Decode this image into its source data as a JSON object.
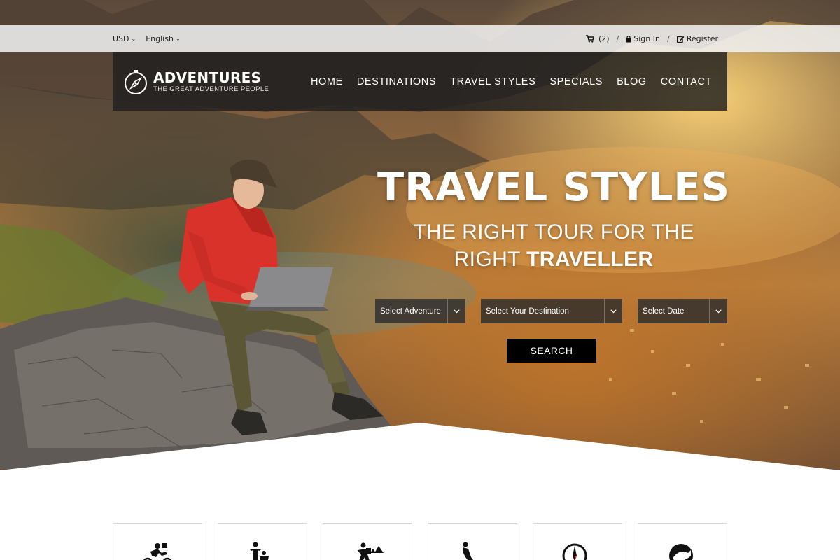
{
  "topbar": {
    "currency": "USD",
    "language": "English",
    "cart_count": "(2)",
    "separator": "/",
    "signin_label": "Sign In",
    "register_label": "Register"
  },
  "header": {
    "brand_name": "ADVENTURES",
    "brand_tagline": "THE GREAT ADVENTURE PEOPLE",
    "nav": [
      "HOME",
      "DESTINATIONS",
      "TRAVEL STYLES",
      "SPECIALS",
      "BLOG",
      "CONTACT"
    ]
  },
  "hero": {
    "title": "TRAVEL STYLES",
    "subtitle_line1": "THE RIGHT TOUR FOR THE",
    "subtitle_line2_regular": "RIGHT ",
    "subtitle_line2_bold": "TRAVELLER"
  },
  "search": {
    "adventure_placeholder": "Select Adventure",
    "destination_placeholder": "Select Your Destination",
    "date_placeholder": "Select Date",
    "button_label": "SEARCH"
  },
  "style_cards": [
    {
      "icon": "cycling-icon"
    },
    {
      "icon": "family-icon"
    },
    {
      "icon": "hiking-icon"
    },
    {
      "icon": "skiing-icon"
    },
    {
      "icon": "compass-icon"
    },
    {
      "icon": "wildlife-icon"
    }
  ],
  "colors": {
    "header_bg": "#1e1e1e",
    "topbar_bg": "#f0f0f0",
    "button_bg": "#000000",
    "accent_red": "#d8322b"
  }
}
